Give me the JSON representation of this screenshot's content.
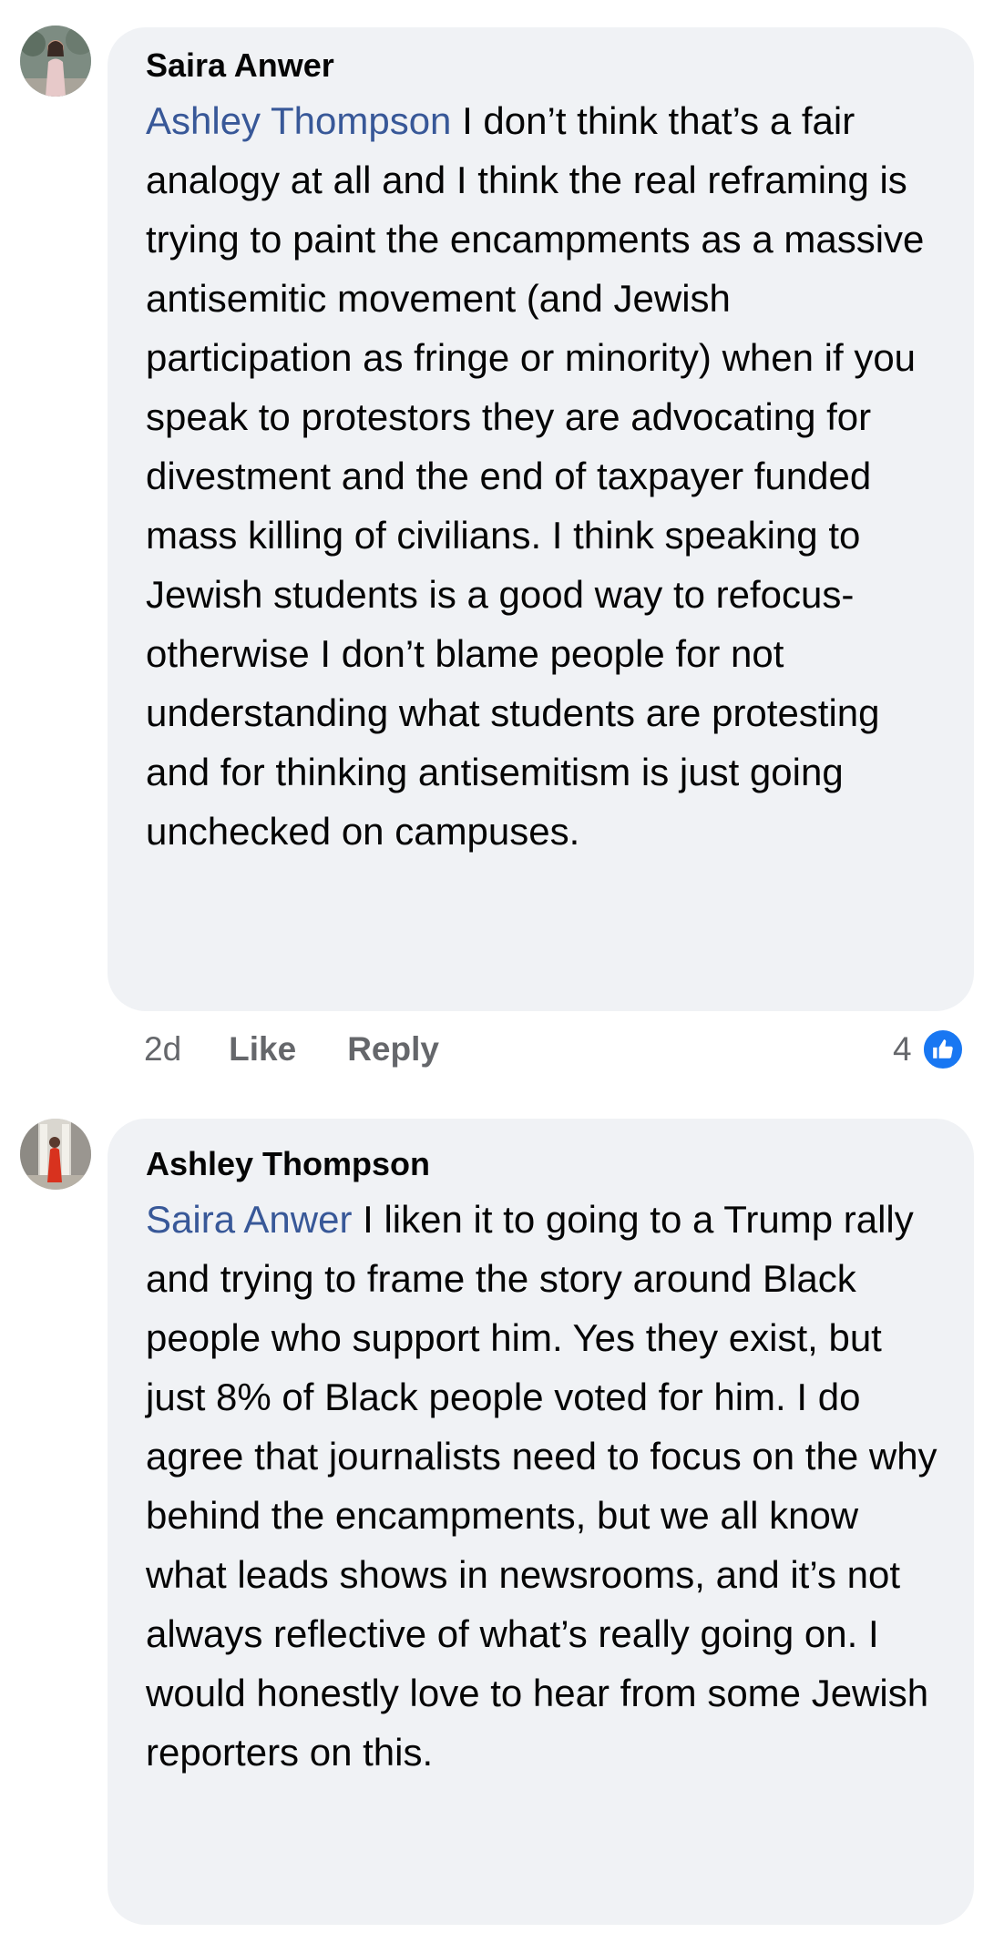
{
  "comments": [
    {
      "author": "Saira Anwer",
      "mention": "Ashley Thompson",
      "text": " I don’t think that’s a fair analogy at all and I think the real reframing is trying to paint the encampments as a massive antisemitic movement (and Jewish participation as fringe or minority) when if you speak to protestors they are advocating for divestment and the end of taxpayer funded mass killing of civilians. I think speaking to Jewish students is a good way to refocus- otherwise I don’t blame people for not understanding what students are protesting and for thinking antisemitism is just going unchecked on campuses.",
      "time": "2d",
      "like_label": "Like",
      "reply_label": "Reply",
      "reaction_count": "4",
      "reaction_icon": "thumbs-up-icon"
    },
    {
      "author": "Ashley Thompson",
      "mention": "Saira Anwer",
      "text": " I liken it to going to a Trump rally and trying to frame the story around Black people who support him. Yes they exist, but just 8% of Black people voted for him. I do agree that journalists need to focus on the why behind the encampments, but we all know what leads shows in newsrooms, and it’s not always reflective of what’s really going on. I would honestly love to hear from some Jewish reporters on this."
    }
  ],
  "colors": {
    "bubble": "#f0f2f5",
    "mention": "#385898",
    "meta": "#65676b",
    "like_badge": "#1877f2"
  }
}
